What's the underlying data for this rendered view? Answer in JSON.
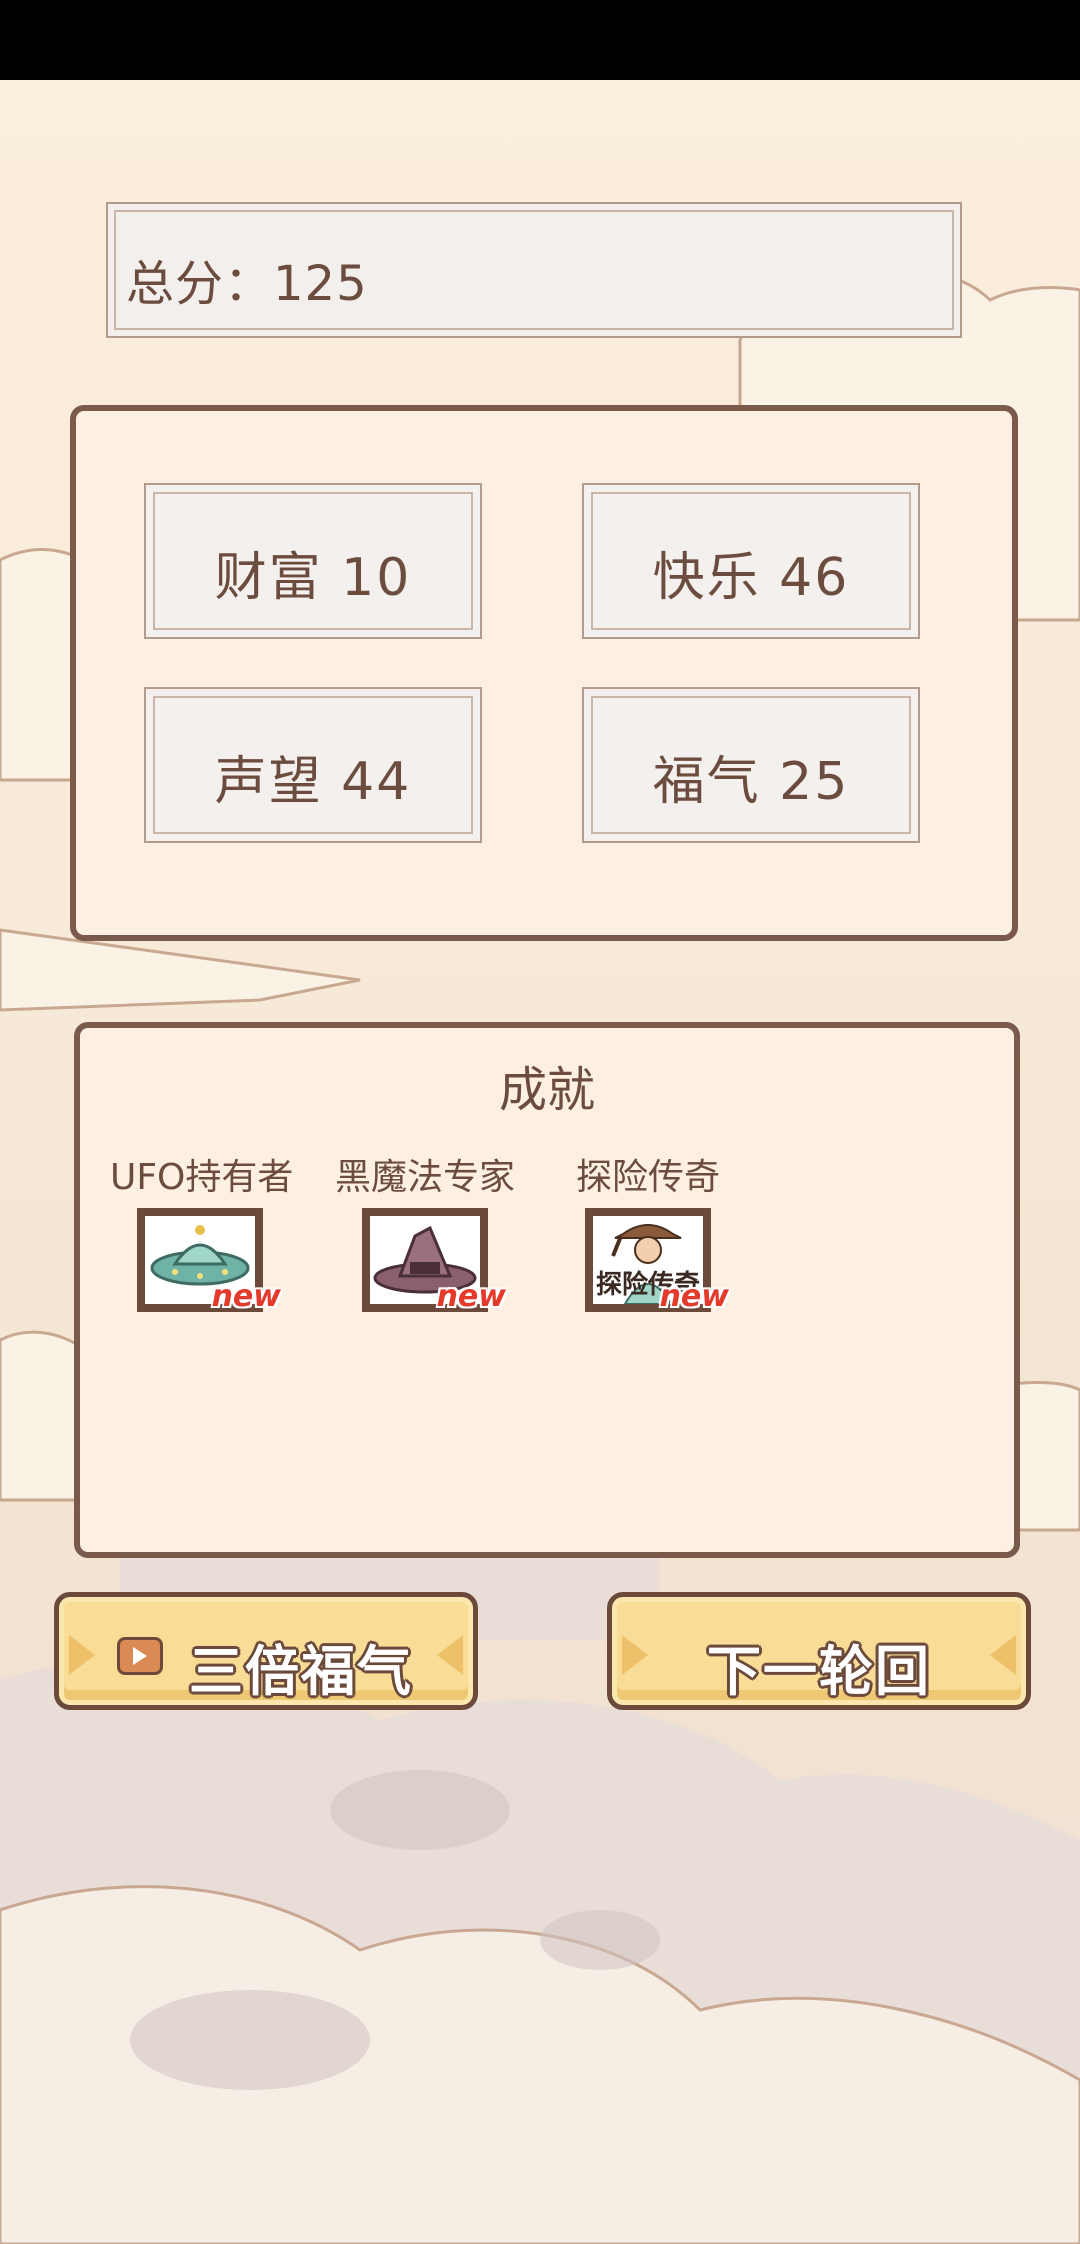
{
  "score": {
    "text": "总分：125"
  },
  "stats": [
    {
      "text": "财富 10"
    },
    {
      "text": "快乐 46"
    },
    {
      "text": "声望 44"
    },
    {
      "text": "福气 25"
    }
  ],
  "achievements": {
    "title": "成就",
    "items": [
      {
        "name": "UFO持有者",
        "badge": "new",
        "icon": "ufo-icon"
      },
      {
        "name": "黑魔法专家",
        "badge": "new",
        "icon": "witch-hat-icon"
      },
      {
        "name": "探险传奇",
        "badge": "new",
        "icon": "explorer-icon",
        "img_text": "探险传奇"
      }
    ]
  },
  "buttons": {
    "triple": "三倍福气",
    "next": "下一轮回"
  },
  "colors": {
    "brown": "#6b4a3c",
    "button_fill": "#f9dc95",
    "new_badge": "#e43a2b"
  }
}
